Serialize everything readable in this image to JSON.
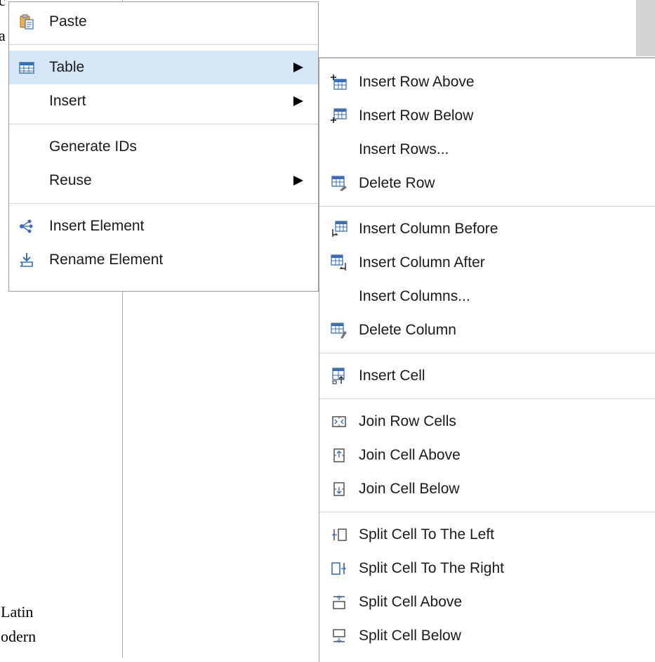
{
  "background": {
    "fragment_top": "c",
    "fragment_a": "a",
    "fragment_latin": "Latin",
    "fragment_odern": "odern"
  },
  "context_menu": {
    "items": [
      {
        "label": "Paste",
        "icon": "paste-icon"
      },
      {
        "label": "Table",
        "icon": "table-icon",
        "submenu": true
      },
      {
        "label": "Insert",
        "submenu": true
      },
      {
        "label": "Generate IDs"
      },
      {
        "label": "Reuse",
        "submenu": true
      },
      {
        "label": "Insert Element",
        "icon": "insert-element-icon"
      },
      {
        "label": "Rename Element",
        "icon": "rename-element-icon"
      }
    ]
  },
  "table_submenu": {
    "items": [
      {
        "label": "Insert Row Above",
        "icon": "insert-row-above-icon"
      },
      {
        "label": "Insert Row Below",
        "icon": "insert-row-below-icon"
      },
      {
        "label": "Insert Rows..."
      },
      {
        "label": "Delete Row",
        "icon": "delete-row-icon"
      },
      {
        "label": "Insert Column Before",
        "icon": "insert-column-before-icon"
      },
      {
        "label": "Insert Column After",
        "icon": "insert-column-after-icon"
      },
      {
        "label": "Insert Columns..."
      },
      {
        "label": "Delete Column",
        "icon": "delete-column-icon"
      },
      {
        "label": "Insert Cell",
        "icon": "insert-cell-icon"
      },
      {
        "label": "Join Row Cells",
        "icon": "join-row-cells-icon"
      },
      {
        "label": "Join Cell Above",
        "icon": "join-cell-above-icon"
      },
      {
        "label": "Join Cell Below",
        "icon": "join-cell-below-icon"
      },
      {
        "label": "Split Cell To The Left",
        "icon": "split-cell-left-icon"
      },
      {
        "label": "Split Cell To The Right",
        "icon": "split-cell-right-icon"
      },
      {
        "label": "Split Cell Above",
        "icon": "split-cell-above-icon"
      },
      {
        "label": "Split Cell Below",
        "icon": "split-cell-below-icon"
      }
    ]
  },
  "colors": {
    "selected_background": "#d5e6f7",
    "menu_border": "#9c9c9c",
    "icon_blue": "#3a6fb5",
    "icon_orange": "#e08a1a"
  }
}
